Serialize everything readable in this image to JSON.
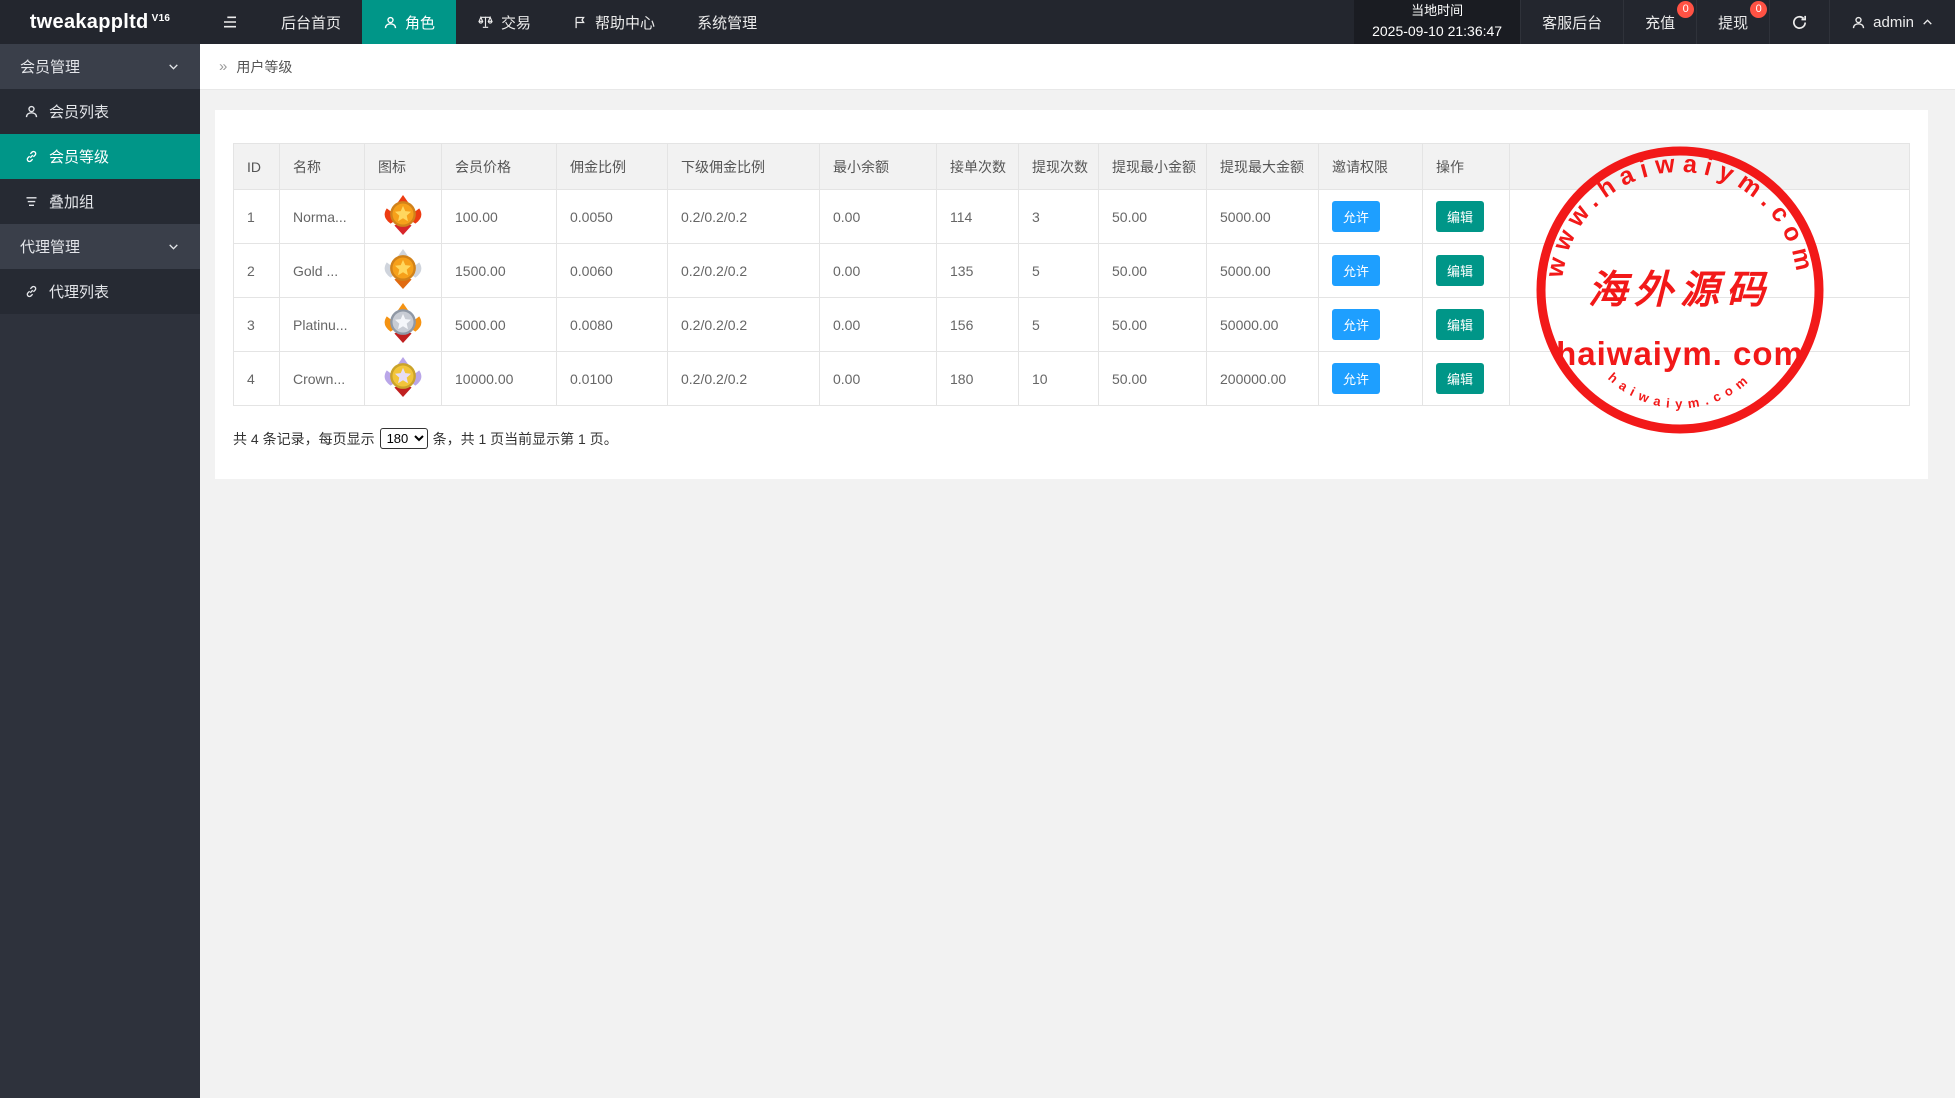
{
  "navbar": {
    "logo": "tweakappltd",
    "logo_sup": "V16",
    "hamburger_icon": "hamburger-icon",
    "items": [
      {
        "name": "nav-item-home",
        "label": "后台首页",
        "icon": null,
        "active": false
      },
      {
        "name": "nav-item-roles",
        "label": "角色",
        "icon": "user-icon",
        "active": true
      },
      {
        "name": "nav-item-trade",
        "label": "交易",
        "icon": "scales-icon",
        "active": false
      },
      {
        "name": "nav-item-help",
        "label": "帮助中心",
        "icon": "flag-icon",
        "active": false
      },
      {
        "name": "nav-item-system",
        "label": "系统管理",
        "icon": null,
        "active": false
      }
    ],
    "time_label": "当地时间",
    "time_value": "2025-09-10 21:36:47",
    "right_items": [
      {
        "name": "nav-item-support",
        "label": "客服后台",
        "badge": null
      },
      {
        "name": "nav-item-recharge",
        "label": "充值",
        "badge": "0"
      },
      {
        "name": "nav-item-withdraw",
        "label": "提现",
        "badge": "0"
      }
    ],
    "refresh_icon": "refresh-icon",
    "user": "admin",
    "user_icon": "user-icon",
    "user_caret_icon": "chevron-up-icon"
  },
  "sidebar": {
    "items": [
      {
        "type": "header",
        "name": "sidebar-group-member-mgmt",
        "label": "会员管理",
        "icon": "chevron-down-icon"
      },
      {
        "type": "link",
        "name": "sidebar-item-member-list",
        "label": "会员列表",
        "icon": "user-icon",
        "active": false
      },
      {
        "type": "link",
        "name": "sidebar-item-member-level",
        "label": "会员等级",
        "icon": "link-icon",
        "active": true
      },
      {
        "type": "link",
        "name": "sidebar-item-stack-group",
        "label": "叠加组",
        "icon": "layers-icon",
        "active": false
      },
      {
        "type": "header",
        "name": "sidebar-group-agent-mgmt",
        "label": "代理管理",
        "icon": "chevron-down-icon"
      },
      {
        "type": "link",
        "name": "sidebar-item-agent-list",
        "label": "代理列表",
        "icon": "link-icon",
        "active": false
      }
    ]
  },
  "breadcrumb": {
    "icon": "double-chevron-icon",
    "glyph": "»",
    "label": "用户等级"
  },
  "table": {
    "columns": [
      "ID",
      "名称",
      "图标",
      "会员价格",
      "佣金比例",
      "下级佣金比例",
      "最小余额",
      "接单次数",
      "提现次数",
      "提现最小金额",
      "提现最大金额",
      "邀请权限",
      "操作"
    ],
    "invite_label": "允许",
    "edit_label": "编辑",
    "rows": [
      {
        "id": "1",
        "name": "Norma...",
        "icon": {
          "name": "medal-normal-icon",
          "back": "#ed3c12",
          "ring": "#d1821a",
          "body": "#f6a01a",
          "star": "#ffd75e",
          "accent": "#d8262a"
        },
        "price": "100.00",
        "commission": "0.0050",
        "sub_commission": "0.2/0.2/0.2",
        "min_balance": "0.00",
        "orders": "114",
        "withdraw_times": "3",
        "withdraw_min": "50.00",
        "withdraw_max": "5000.00"
      },
      {
        "id": "2",
        "name": "Gold ...",
        "icon": {
          "name": "medal-gold-icon",
          "back": "#cfd4dc",
          "ring": "#d1821a",
          "body": "#f6a01a",
          "star": "#ffd75e",
          "accent": "#e06a10"
        },
        "price": "1500.00",
        "commission": "0.0060",
        "sub_commission": "0.2/0.2/0.2",
        "min_balance": "0.00",
        "orders": "135",
        "withdraw_times": "5",
        "withdraw_min": "50.00",
        "withdraw_max": "5000.00"
      },
      {
        "id": "3",
        "name": "Platinu...",
        "icon": {
          "name": "medal-platinum-icon",
          "back": "#f59312",
          "ring": "#8f98a5",
          "body": "#c8ccd4",
          "star": "#f4f6fa",
          "accent": "#c02020"
        },
        "price": "5000.00",
        "commission": "0.0080",
        "sub_commission": "0.2/0.2/0.2",
        "min_balance": "0.00",
        "orders": "156",
        "withdraw_times": "5",
        "withdraw_min": "50.00",
        "withdraw_max": "50000.00"
      },
      {
        "id": "4",
        "name": "Crown...",
        "icon": {
          "name": "medal-crown-icon",
          "back": "#b9a6e8",
          "ring": "#caa32a",
          "body": "#f2c53a",
          "star": "#e6ddf7",
          "accent": "#c02020"
        },
        "price": "10000.00",
        "commission": "0.0100",
        "sub_commission": "0.2/0.2/0.2",
        "min_balance": "0.00",
        "orders": "180",
        "withdraw_times": "10",
        "withdraw_min": "50.00",
        "withdraw_max": "200000.00"
      }
    ]
  },
  "pagination": {
    "prefix": "共 4 条记录，每页显示",
    "page_size": "180",
    "suffix": "条，共 1 页当前显示第 1 页。"
  },
  "watermark": {
    "name": "haiwaiym-stamp",
    "arc_top": "www.haiwaiym.com",
    "center": "海外源码",
    "main": "haiwaiym. com",
    "arc_bottom": "haiwaiym.com",
    "color": "#f20d0d"
  },
  "colors": {
    "accent_teal": "#009688",
    "button_blue": "#1e9fff",
    "badge_red": "#ff5244",
    "navbar_bg": "#23262e",
    "sidebar_bg": "#2e323c",
    "sidebar_header_bg": "#3a3f4a",
    "sidebar_item_bg": "#262a33",
    "stamp_red": "#f20d0d"
  }
}
